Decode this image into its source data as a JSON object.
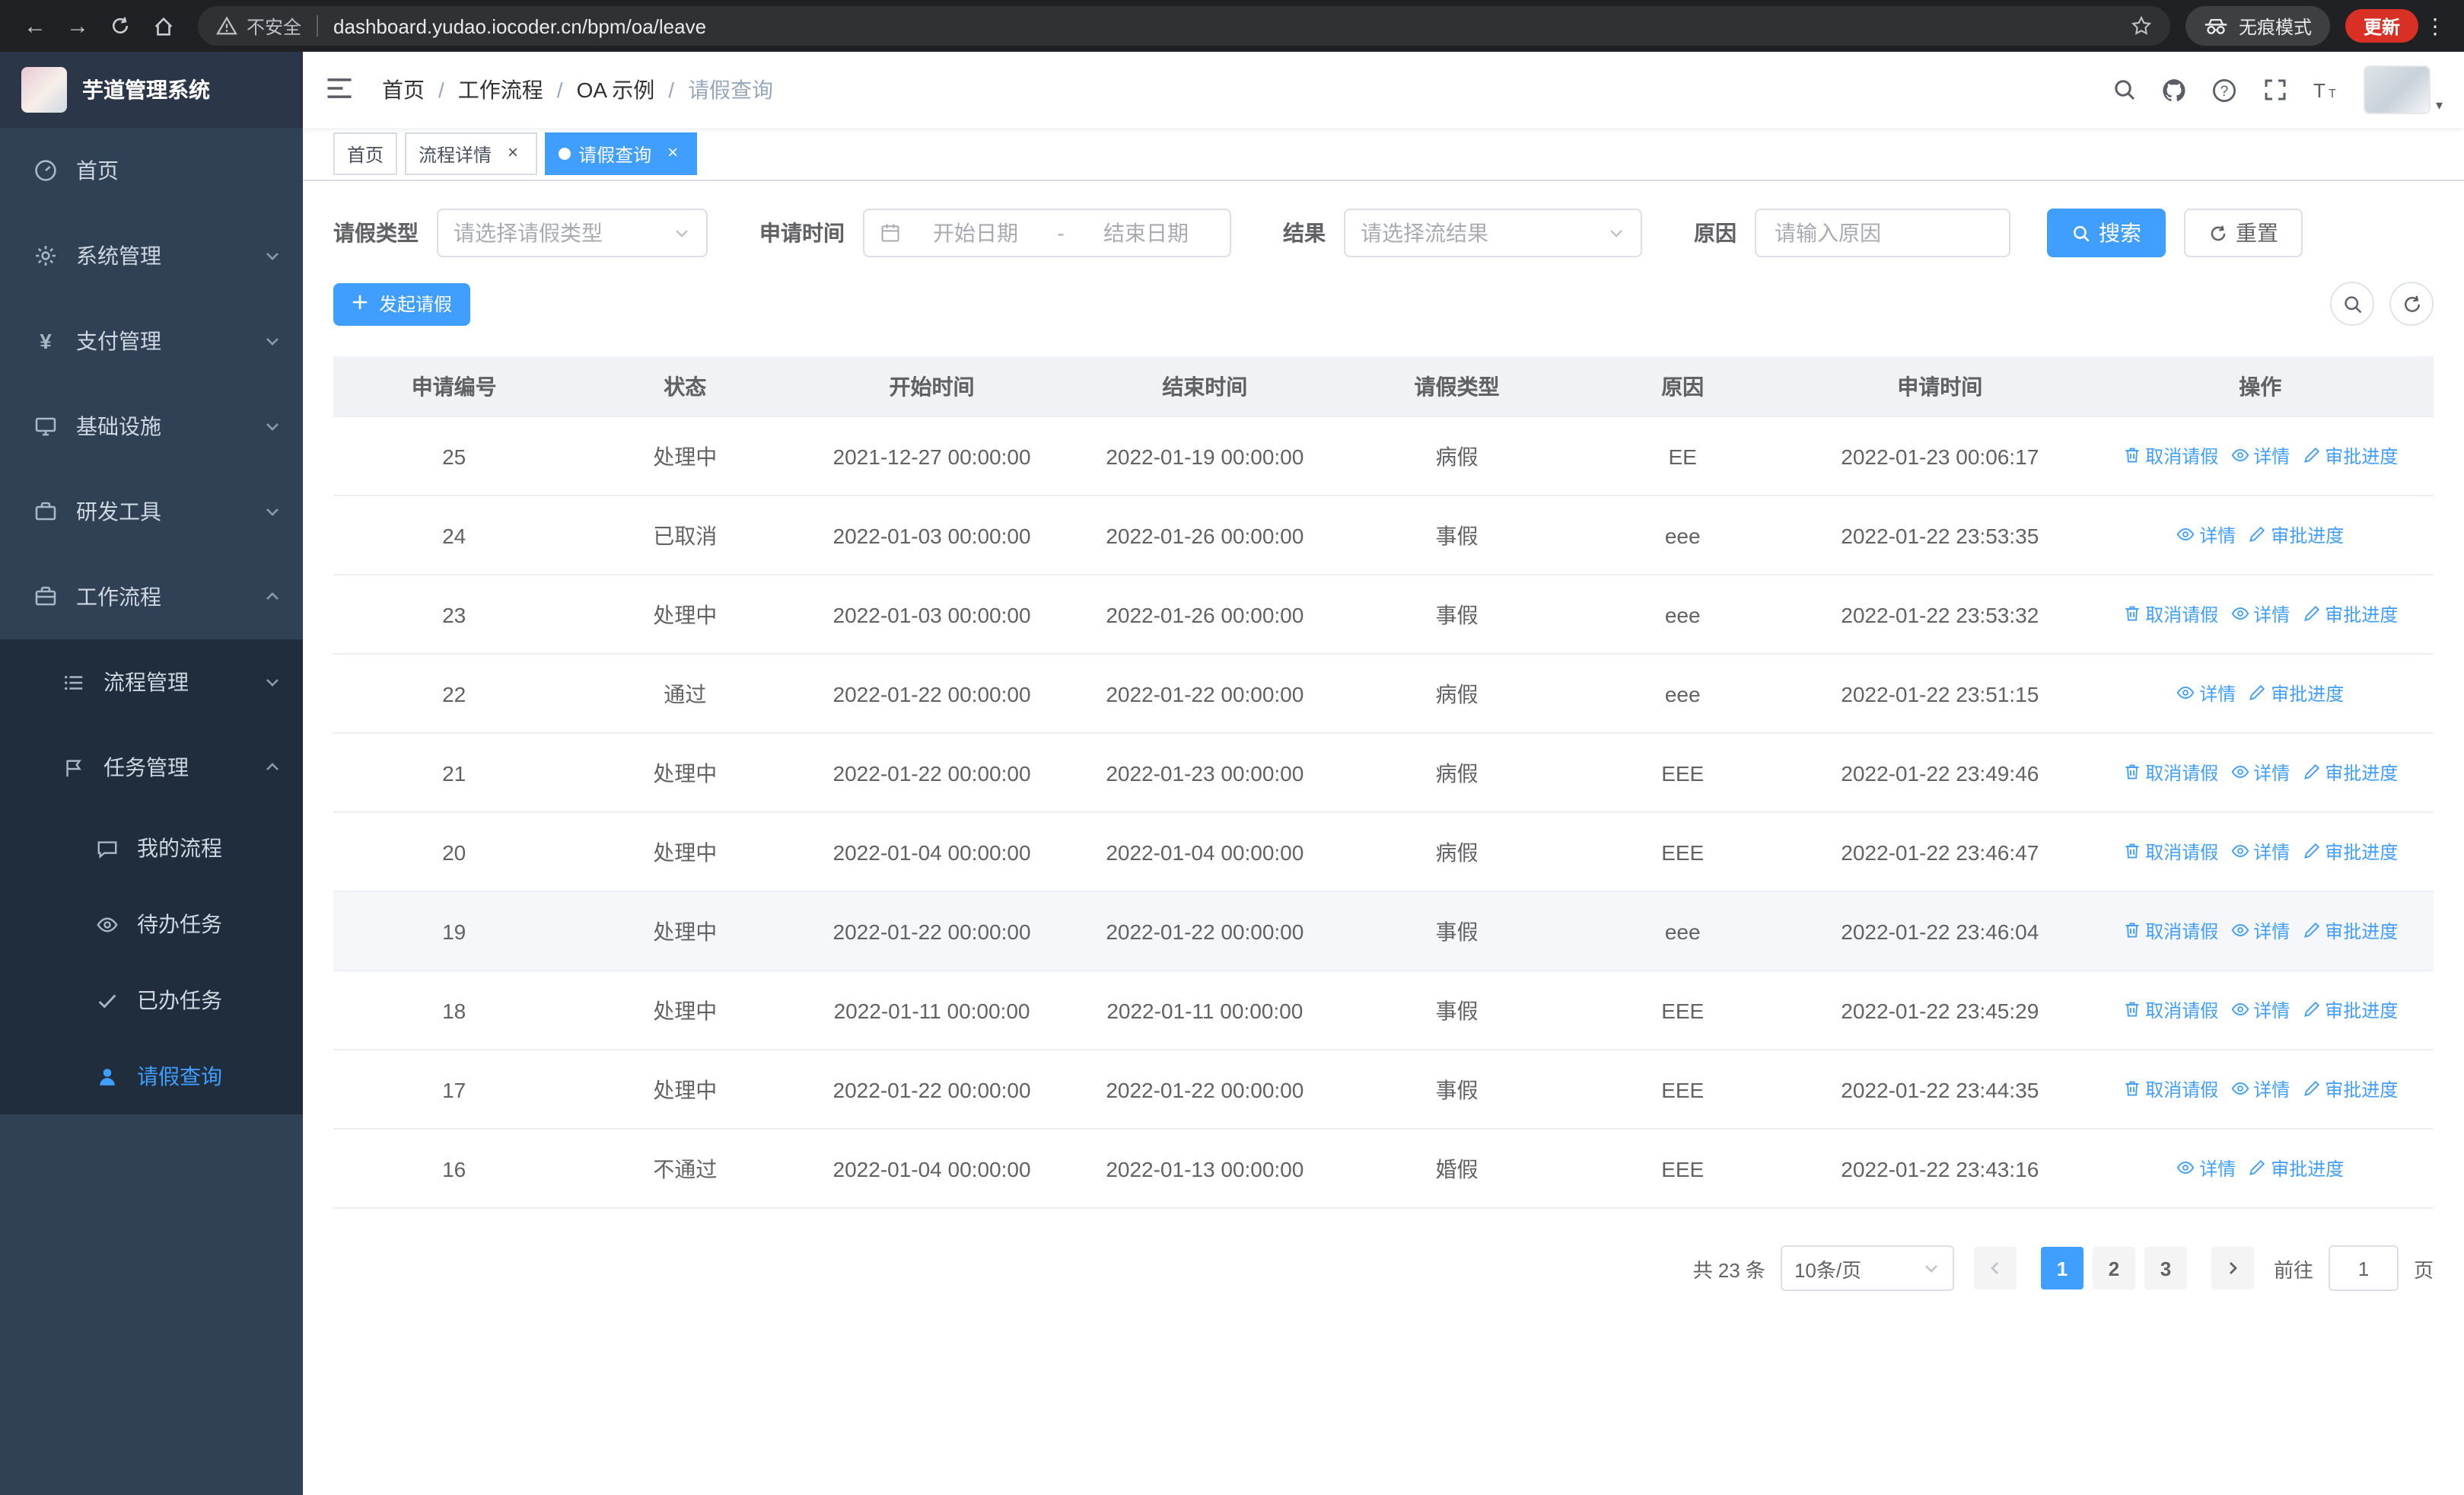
{
  "browser": {
    "security": "不安全",
    "url": "dashboard.yudao.iocoder.cn/bpm/oa/leave",
    "incognito": "无痕模式",
    "update": "更新"
  },
  "colors": {
    "accent": "#409eff",
    "sidebar_bg": "#304156",
    "submenu_bg": "#1f2d3d",
    "chrome_bg": "#202124",
    "table_header_bg": "#f0f2f5"
  },
  "icons": {
    "nav": [
      "back-arrow",
      "forward-arrow",
      "reload",
      "home"
    ],
    "omnibox": [
      "warning-triangle",
      "bookmark-star"
    ],
    "chrome_right": [
      "incognito-spy",
      "kebab-menu"
    ],
    "header_right": [
      "magnifier",
      "github-mark",
      "question-circle",
      "fullscreen-corners",
      "text-size"
    ],
    "table_actions": {
      "cancel": "trash",
      "detail": "eye",
      "progress": "pen"
    }
  },
  "sidebar": {
    "brand": "芋道管理系统",
    "menu": [
      {
        "label": "首页"
      },
      {
        "label": "系统管理"
      },
      {
        "label": "支付管理"
      },
      {
        "label": "基础设施"
      },
      {
        "label": "研发工具"
      },
      {
        "label": "工作流程"
      }
    ],
    "submenu": [
      {
        "label": "流程管理"
      },
      {
        "label": "任务管理"
      }
    ],
    "task_children": [
      {
        "label": "我的流程"
      },
      {
        "label": "待办任务"
      },
      {
        "label": "已办任务"
      },
      {
        "label": "请假查询"
      }
    ]
  },
  "header": {
    "breadcrumb": [
      "首页",
      "工作流程",
      "OA 示例",
      "请假查询"
    ],
    "separator": "/"
  },
  "tabs": [
    {
      "label": "首页"
    },
    {
      "label": "流程详情"
    },
    {
      "label": "请假查询"
    }
  ],
  "filters": {
    "type_label": "请假类型",
    "type_placeholder": "请选择请假类型",
    "time_label": "申请时间",
    "start_placeholder": "开始日期",
    "range_separator": "-",
    "end_placeholder": "结束日期",
    "result_label": "结果",
    "result_placeholder": "请选择流结果",
    "reason_label": "原因",
    "reason_placeholder": "请输入原因",
    "search": "搜索",
    "reset": "重置"
  },
  "toolbar": {
    "create": "发起请假"
  },
  "table": {
    "headers": [
      "申请编号",
      "状态",
      "开始时间",
      "结束时间",
      "请假类型",
      "原因",
      "申请时间",
      "操作"
    ],
    "action_labels": {
      "cancel": "取消请假",
      "detail": "详情",
      "progress": "审批进度"
    },
    "rows": [
      {
        "id": "25",
        "status": "处理中",
        "start": "2021-12-27 00:00:00",
        "end": "2022-01-19 00:00:00",
        "type": "病假",
        "reason": "EE",
        "applied": "2022-01-23 00:06:17",
        "actions": [
          "cancel",
          "detail",
          "progress"
        ]
      },
      {
        "id": "24",
        "status": "已取消",
        "start": "2022-01-03 00:00:00",
        "end": "2022-01-26 00:00:00",
        "type": "事假",
        "reason": "eee",
        "applied": "2022-01-22 23:53:35",
        "actions": [
          "detail",
          "progress"
        ]
      },
      {
        "id": "23",
        "status": "处理中",
        "start": "2022-01-03 00:00:00",
        "end": "2022-01-26 00:00:00",
        "type": "事假",
        "reason": "eee",
        "applied": "2022-01-22 23:53:32",
        "actions": [
          "cancel",
          "detail",
          "progress"
        ]
      },
      {
        "id": "22",
        "status": "通过",
        "start": "2022-01-22 00:00:00",
        "end": "2022-01-22 00:00:00",
        "type": "病假",
        "reason": "eee",
        "applied": "2022-01-22 23:51:15",
        "actions": [
          "detail",
          "progress"
        ]
      },
      {
        "id": "21",
        "status": "处理中",
        "start": "2022-01-22 00:00:00",
        "end": "2022-01-23 00:00:00",
        "type": "病假",
        "reason": "EEE",
        "applied": "2022-01-22 23:49:46",
        "actions": [
          "cancel",
          "detail",
          "progress"
        ]
      },
      {
        "id": "20",
        "status": "处理中",
        "start": "2022-01-04 00:00:00",
        "end": "2022-01-04 00:00:00",
        "type": "病假",
        "reason": "EEE",
        "applied": "2022-01-22 23:46:47",
        "actions": [
          "cancel",
          "detail",
          "progress"
        ]
      },
      {
        "id": "19",
        "status": "处理中",
        "start": "2022-01-22 00:00:00",
        "end": "2022-01-22 00:00:00",
        "type": "事假",
        "reason": "eee",
        "applied": "2022-01-22 23:46:04",
        "actions": [
          "cancel",
          "detail",
          "progress"
        ],
        "hover": true
      },
      {
        "id": "18",
        "status": "处理中",
        "start": "2022-01-11 00:00:00",
        "end": "2022-01-11 00:00:00",
        "type": "事假",
        "reason": "EEE",
        "applied": "2022-01-22 23:45:29",
        "actions": [
          "cancel",
          "detail",
          "progress"
        ]
      },
      {
        "id": "17",
        "status": "处理中",
        "start": "2022-01-22 00:00:00",
        "end": "2022-01-22 00:00:00",
        "type": "事假",
        "reason": "EEE",
        "applied": "2022-01-22 23:44:35",
        "actions": [
          "cancel",
          "detail",
          "progress"
        ]
      },
      {
        "id": "16",
        "status": "不通过",
        "start": "2022-01-04 00:00:00",
        "end": "2022-01-13 00:00:00",
        "type": "婚假",
        "reason": "EEE",
        "applied": "2022-01-22 23:43:16",
        "actions": [
          "detail",
          "progress"
        ]
      }
    ]
  },
  "pagination": {
    "total": "共 23 条",
    "page_size": "10条/页",
    "pages": [
      "1",
      "2",
      "3"
    ],
    "active_page": "1",
    "goto_label": "前往",
    "goto_value": "1",
    "page_unit": "页"
  }
}
